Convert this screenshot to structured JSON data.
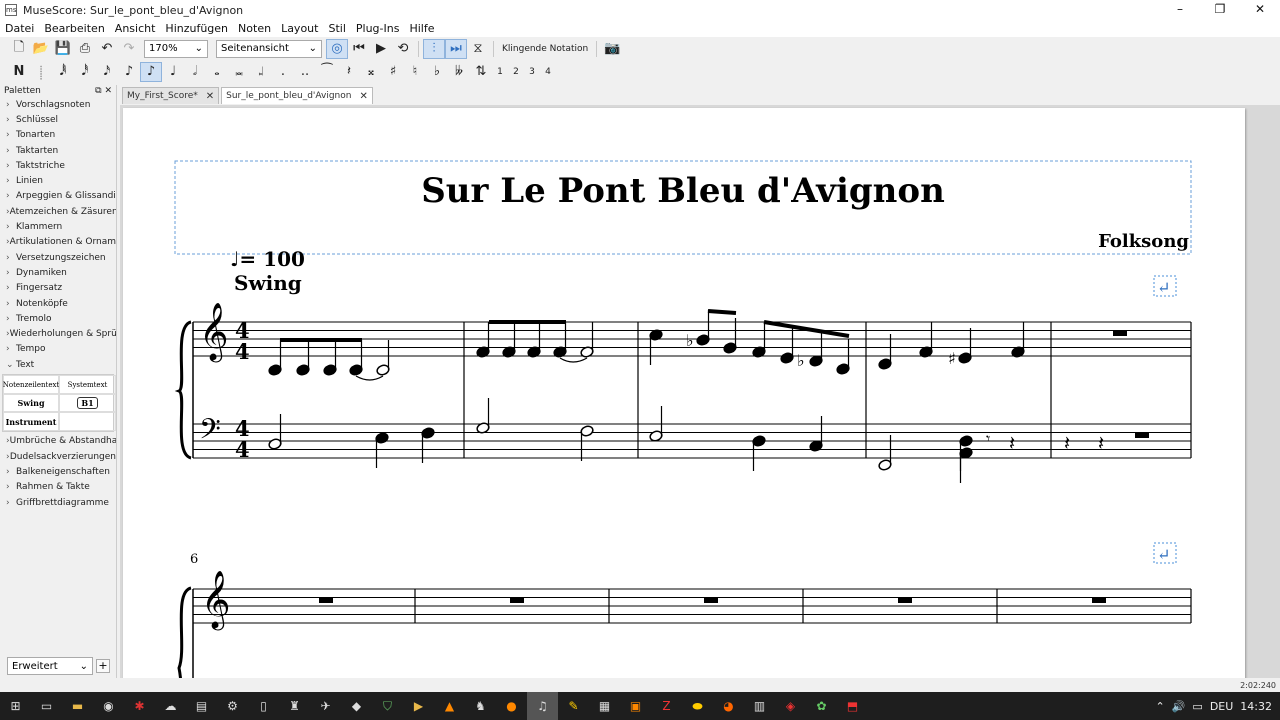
{
  "window": {
    "title": "MuseScore: Sur_le_pont_bleu_d'Avignon",
    "minimize": "–",
    "maximize": "❐",
    "close": "✕",
    "app_icon": "ms"
  },
  "menu": [
    "Datei",
    "Bearbeiten",
    "Ansicht",
    "Hinzufügen",
    "Noten",
    "Layout",
    "Stil",
    "Plug-Ins",
    "Hilfe"
  ],
  "toolbar": {
    "zoom": "170%",
    "view_mode": "Seitenansicht",
    "concert_pitch": "Klingende Notation"
  },
  "note_input": {
    "voices": [
      "1",
      "2",
      "3",
      "4"
    ]
  },
  "palettes": {
    "header": "Paletten",
    "items_before": [
      "Vorschlagsnoten",
      "Schlüssel",
      "Tonarten",
      "Taktarten",
      "Taktstriche",
      "Linien",
      "Arpeggien & Glissandi",
      "Atemzeichen & Zäsuren",
      "Klammern",
      "Artikulationen & Ornamente",
      "Versetzungszeichen",
      "Dynamiken",
      "Fingersatz",
      "Notenköpfe",
      "Tremolo",
      "Wiederholungen & Sprünge",
      "Tempo"
    ],
    "open_item": "Text",
    "text_cells": [
      "Notenzeilentext",
      "Systemtext",
      "Swing",
      "B1",
      "Instrument",
      ""
    ],
    "items_after": [
      "Umbrüche & Abstandhalter",
      "Dudelsackverzierungen",
      "Balkeneigenschaften",
      "Rahmen & Takte",
      "Griffbrettdiagramme"
    ],
    "footer_select": "Erweitert",
    "footer_add": "+"
  },
  "tabs": [
    {
      "label": "My_First_Score*",
      "close": "✕"
    },
    {
      "label": "Sur_le_pont_bleu_d'Avignon",
      "close": "✕"
    }
  ],
  "score": {
    "title": "Sur Le Pont Bleu d'Avignon",
    "composer": "Folksong",
    "tempo_text": "♩= 100",
    "swing_text": "Swing",
    "time_sig_top": "4",
    "time_sig_bottom": "4",
    "second_system_measure": "6"
  },
  "status": {
    "position": "2:02:240"
  },
  "taskbar": {
    "lang": "DEU",
    "time": "14:32"
  }
}
